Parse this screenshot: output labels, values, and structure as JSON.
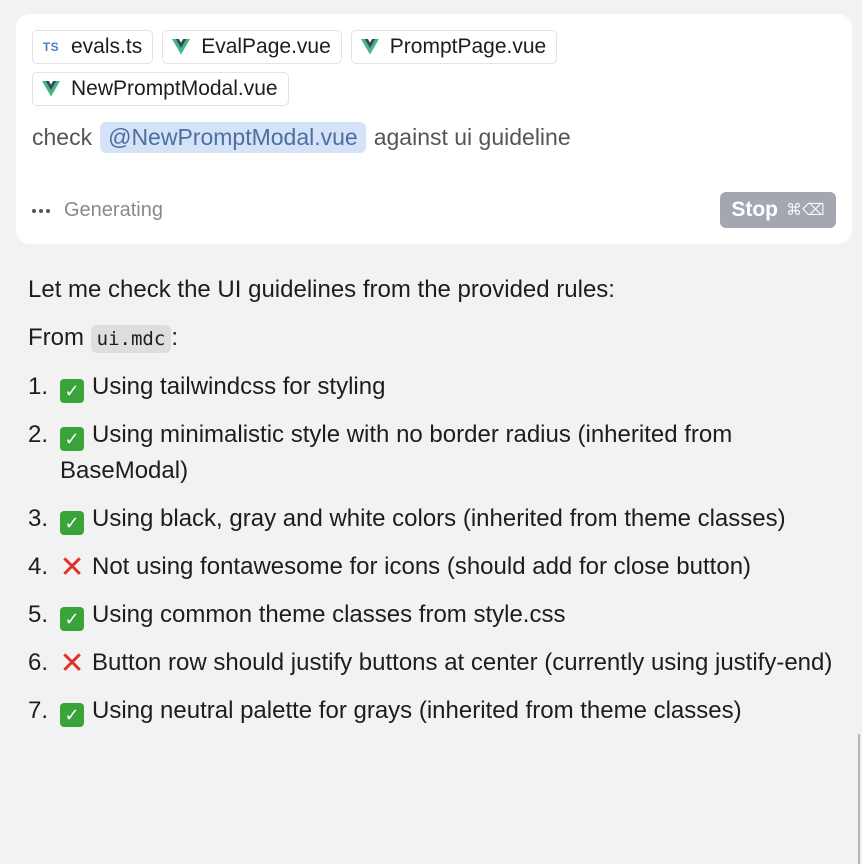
{
  "composer": {
    "chips": [
      {
        "label": "evals.ts",
        "icon": "typescript-icon",
        "icon_text": "TS"
      },
      {
        "label": "EvalPage.vue",
        "icon": "vue-icon"
      },
      {
        "label": "PromptPage.vue",
        "icon": "vue-icon"
      },
      {
        "label": "NewPromptModal.vue",
        "icon": "vue-icon"
      }
    ],
    "prompt_before": "check",
    "mention": "@NewPromptModal.vue",
    "prompt_after": "against ui guideline",
    "status_text": "Generating",
    "stop_label": "Stop",
    "stop_shortcut": "⌘⌫"
  },
  "response": {
    "intro": "Let me check the UI guidelines from the provided rules:",
    "from_prefix": "From",
    "from_code": "ui.mdc",
    "from_suffix": ":",
    "items": [
      {
        "num": "1.",
        "status": "ok",
        "text": "Using tailwindcss for styling"
      },
      {
        "num": "2.",
        "status": "ok",
        "text": "Using minimalistic style with no border radius (inherited from BaseModal)"
      },
      {
        "num": "3.",
        "status": "ok",
        "text": "Using black, gray and white colors (inherited from theme classes)"
      },
      {
        "num": "4.",
        "status": "no",
        "text": "Not using fontawesome for icons (should add for close button)"
      },
      {
        "num": "5.",
        "status": "ok",
        "text": "Using common theme classes from style.css"
      },
      {
        "num": "6.",
        "status": "no",
        "text": "Button row should justify buttons at center (currently using justify-end)"
      },
      {
        "num": "7.",
        "status": "ok",
        "text": "Using neutral palette for grays (inherited from theme classes)"
      }
    ]
  },
  "colors": {
    "background": "#f2f2f2",
    "mention_bg": "#d5e3f8",
    "stop_bg": "#a2a7b0",
    "check_green": "#3aa33a",
    "cross_red": "#e0302c"
  }
}
